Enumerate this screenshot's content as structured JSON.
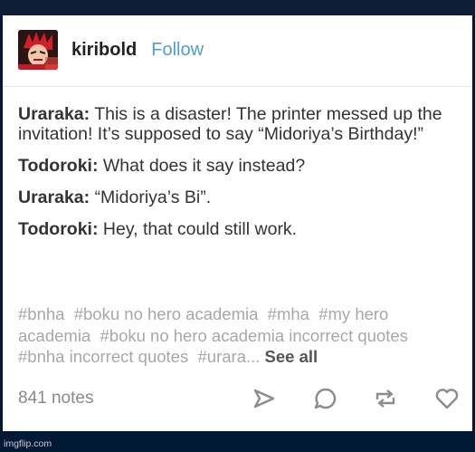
{
  "post": {
    "username": "kiribold",
    "follow_label": "Follow",
    "dialogue": [
      {
        "speaker": "Uraraka:",
        "text": "This is a disaster! The printer messed up the invitation! It’s supposed to say “Midoriya’s Birthday!”"
      },
      {
        "speaker": "Todoroki:",
        "text": "What does it say instead?"
      },
      {
        "speaker": "Uraraka:",
        "text": "“Midoriya’s Bi”."
      },
      {
        "speaker": "Todoroki:",
        "text": "Hey, that could still work."
      }
    ],
    "tags": [
      "#bnha",
      "#boku no hero academia",
      "#mha",
      "#my hero academia",
      "#boku no hero academia incorrect quotes",
      "#bnha incorrect quotes",
      "#urara..."
    ],
    "see_all_label": "See all",
    "notes_count": "841 notes"
  },
  "icons": {
    "share": "send-icon",
    "reply": "reply-bubble-icon",
    "reblog": "reblog-icon",
    "like": "heart-icon"
  },
  "colors": {
    "page_background": "#001935",
    "follow_link": "#529ecc",
    "tag_text": "#a8a8a8",
    "icon_gray": "#8c8c8c"
  },
  "watermark": "imgflip.com"
}
